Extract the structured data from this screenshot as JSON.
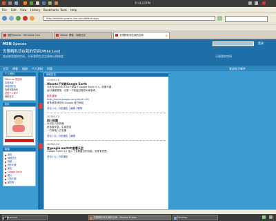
{
  "panel": {
    "clock": "Fri 8:23 PM"
  },
  "menubar": [
    "File",
    "Edit",
    "View",
    "History",
    "Bookmarks",
    "Tools",
    "Help"
  ],
  "navbar": {
    "url": "http://mikelee.spaces.live.com/default.aspx"
  },
  "tabs": [
    {
      "label": "我的Spaces - Windows Live"
    },
    {
      "label": "Yahoo! 博客 - 网络日志"
    },
    {
      "label": "无限精彩尽在我的空间"
    }
  ],
  "site": {
    "brand": "MSN",
    "brand_sub": "Spaces",
    "title": "无限精彩尽在我的空间(Mike Lee)",
    "subtitle": "欢迎来到我的空间，分享我的生活点滴和心得体会",
    "subtitle_right": "订阅我的空间",
    "head_link": "登录",
    "nav": [
      "主页",
      "博客",
      "相册",
      "个人资料",
      "列表"
    ],
    "nav_right": "发送电子邮件"
  },
  "sidebar": {
    "profile_head": "个人资料",
    "profile_lines": [
      "Mike Lee 的空间",
      "发送消息",
      "添加到好友",
      "查看完整资料",
      "这是个人简介",
      "网络日志"
    ],
    "photo_head": "相片",
    "links_head": "链接",
    "links": [
      "首页",
      "网络日志",
      "相册",
      "音乐列表",
      "朋友",
      "Google Earth",
      "图片",
      "日志列表",
      "留言板"
    ]
  },
  "content": {
    "head": "网络日志",
    "posts": [
      {
        "date": "2008/5/16",
        "title": "Ubuntu下安装Google Earth",
        "body": [
          "今天在Ubuntu 8.04下安装了Google Earth 4.3，效果不错，",
          "运行速度很快，记录一下安装过程供大家参考。"
        ],
        "meta": "评论 (0) | 引用通告 | 编辑 | 删除",
        "extra": [
          "相关链接：",
          "http://earth.google.com/intl/zh-CN/",
          "更多信息请访问 Google 官方网站"
        ]
      },
      {
        "date": "2008/5/12",
        "title": "四川地震",
        "body": [
          "为灾区人民祈福",
          "愿逝者安息，生者坚强",
          "一方有难八方支援"
        ],
        "meta": "评论 (2) | 引用通告 | 编辑"
      },
      {
        "date": "2008/5/10",
        "title": "在google earth中查看天空",
        "body": [
          "Google Earth 4.2 加入了查看星空的功能，非常有意思。"
        ],
        "meta": "评论 (1) | 引用通告"
      }
    ]
  },
  "taskbar": [
    {
      "label": "Terminal"
    },
    {
      "label": "无限精彩尽在我的空间 - Mozilla Firefox"
    },
    {
      "label": "Desktop"
    }
  ],
  "colors": {
    "header": "#1e6fa8",
    "page_bg": "#3a9bd0",
    "panel": "#3b3b3b"
  }
}
